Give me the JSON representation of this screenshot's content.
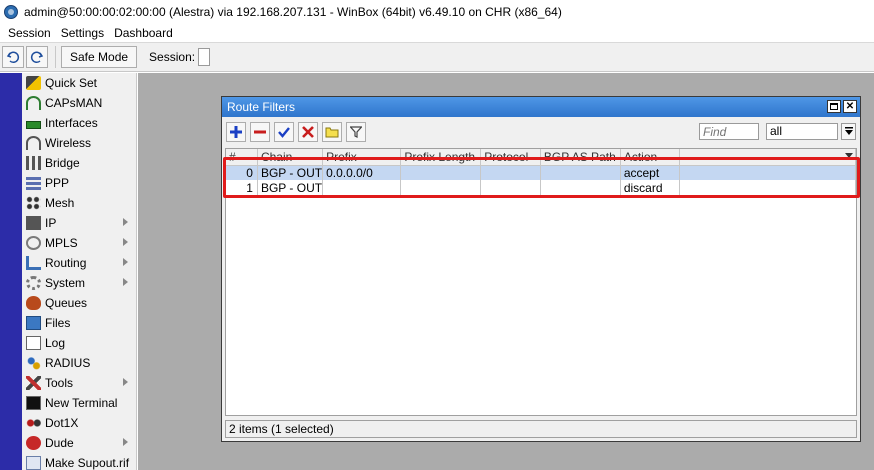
{
  "window": {
    "title": "admin@50:00:00:02:00:00 (Alestra) via 192.168.207.131 - WinBox (64bit) v6.49.10 on CHR (x86_64)"
  },
  "menu": {
    "items": [
      "Session",
      "Settings",
      "Dashboard"
    ]
  },
  "toolbar": {
    "safe_mode_label": "Safe Mode",
    "session_label": "Session:"
  },
  "sidebar": {
    "items": [
      {
        "label": "Quick Set",
        "icon": "wand-icon",
        "submenu": false
      },
      {
        "label": "CAPsMAN",
        "icon": "antenna-icon",
        "submenu": false
      },
      {
        "label": "Interfaces",
        "icon": "interfaces-icon",
        "submenu": false
      },
      {
        "label": "Wireless",
        "icon": "wireless-icon",
        "submenu": false
      },
      {
        "label": "Bridge",
        "icon": "bridge-icon",
        "submenu": false
      },
      {
        "label": "PPP",
        "icon": "ppp-icon",
        "submenu": false
      },
      {
        "label": "Mesh",
        "icon": "mesh-icon",
        "submenu": false
      },
      {
        "label": "IP",
        "icon": "ip-icon",
        "submenu": true
      },
      {
        "label": "MPLS",
        "icon": "mpls-icon",
        "submenu": true
      },
      {
        "label": "Routing",
        "icon": "routing-icon",
        "submenu": true
      },
      {
        "label": "System",
        "icon": "gear-icon",
        "submenu": true
      },
      {
        "label": "Queues",
        "icon": "queues-icon",
        "submenu": false
      },
      {
        "label": "Files",
        "icon": "files-icon",
        "submenu": false
      },
      {
        "label": "Log",
        "icon": "log-icon",
        "submenu": false
      },
      {
        "label": "RADIUS",
        "icon": "radius-icon",
        "submenu": false
      },
      {
        "label": "Tools",
        "icon": "tools-icon",
        "submenu": true
      },
      {
        "label": "New Terminal",
        "icon": "terminal-icon",
        "submenu": false
      },
      {
        "label": "Dot1X",
        "icon": "dot1x-icon",
        "submenu": false
      },
      {
        "label": "Dude",
        "icon": "dude-icon",
        "submenu": true
      },
      {
        "label": "Make Supout.rif",
        "icon": "supout-icon",
        "submenu": false
      }
    ]
  },
  "route_filters": {
    "title": "Route Filters",
    "find_placeholder": "Find",
    "filter_value": "all",
    "columns": [
      "#",
      "Chain",
      "Prefix",
      "Prefix Length",
      "Protocol",
      "BGP AS Path",
      "Action"
    ],
    "rows": [
      {
        "num": "0",
        "chain": "BGP - OUT",
        "prefix": "0.0.0.0/0",
        "prefix_length": "",
        "protocol": "",
        "bgp_as_path": "",
        "action": "accept",
        "selected": true
      },
      {
        "num": "1",
        "chain": "BGP - OUT",
        "prefix": "",
        "prefix_length": "",
        "protocol": "",
        "bgp_as_path": "",
        "action": "discard",
        "selected": false
      }
    ],
    "status": "2 items (1 selected)"
  },
  "colors": {
    "title_bar_blue": "#3f8de0",
    "selection": "#c4d7f2",
    "highlight_red": "#e01b1b",
    "strip_blue": "#2c2ca8"
  }
}
